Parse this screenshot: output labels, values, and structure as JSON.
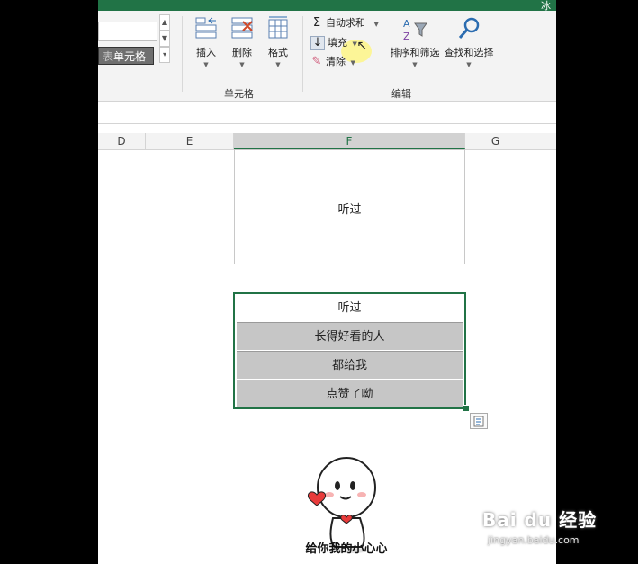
{
  "ribbon": {
    "cells_style_label": "单元格",
    "insert_label": "插入",
    "delete_label": "删除",
    "format_label": "格式",
    "cells_group_label": "单元格",
    "autosum_label": "自动求和",
    "fill_label": "填充",
    "clear_label": "清除",
    "sort_filter_label": "排序和筛选",
    "find_select_label": "查找和选择",
    "editing_group_label": "编辑"
  },
  "columns": [
    "D",
    "E",
    "F",
    "G"
  ],
  "selected_column": "F",
  "cells": {
    "top_cell": "听过",
    "range": [
      "听过",
      "长得好看的人",
      "都给我",
      "点赞了呦"
    ]
  },
  "sticker": {
    "caption": "给你我的小心心"
  },
  "watermark": {
    "brand": "Bai du 经验",
    "url": "jingyan.baidu.com"
  },
  "colors": {
    "excel_green": "#217346",
    "selected_row_fill": "#c6c6c6"
  }
}
